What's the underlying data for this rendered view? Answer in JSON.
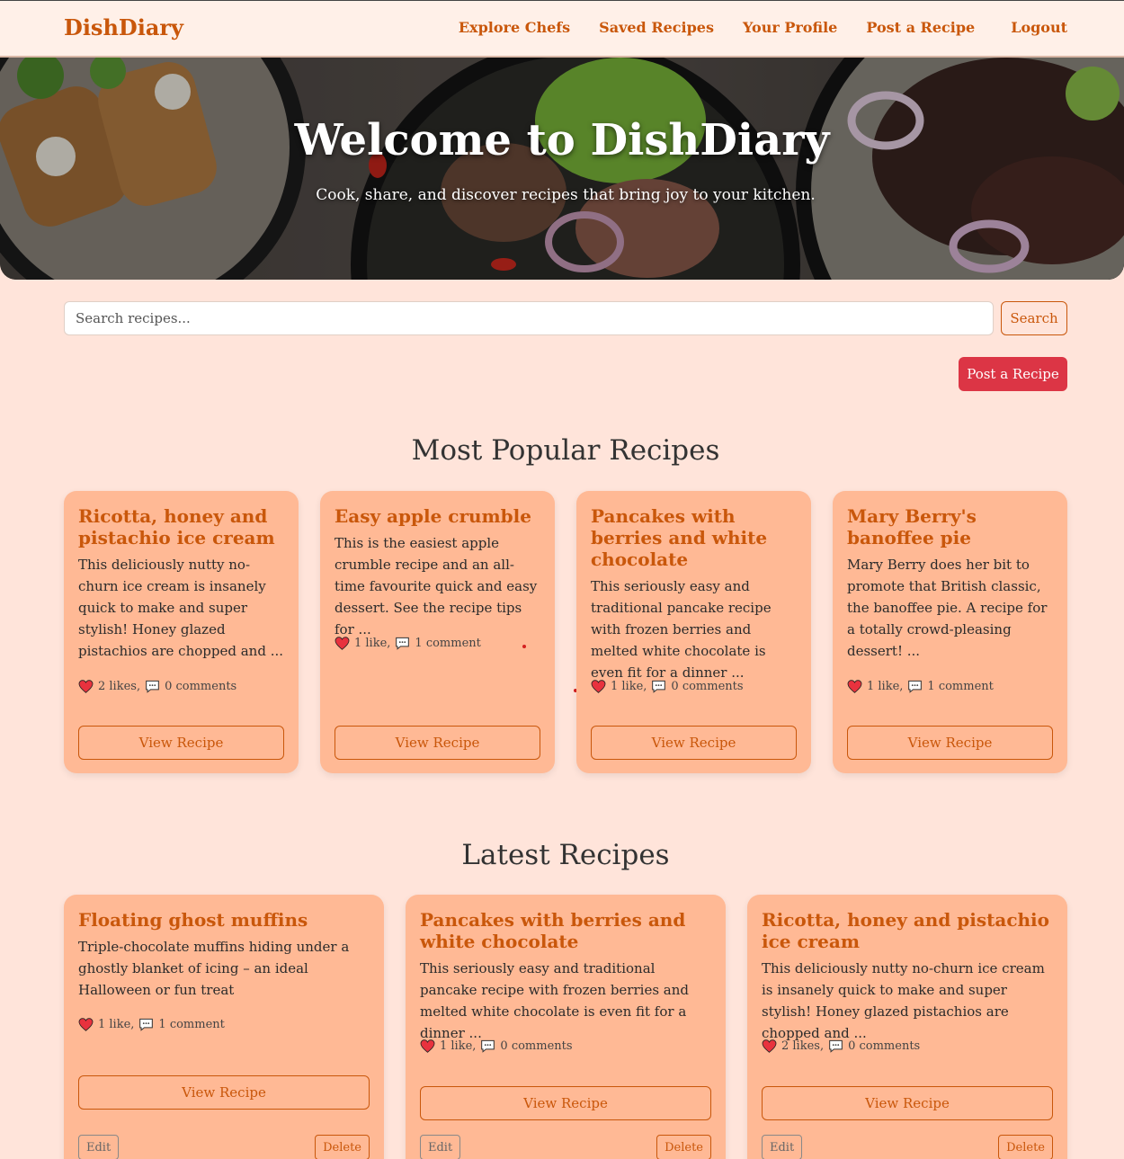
{
  "nav": {
    "brand": "DishDiary",
    "links": [
      "Explore Chefs",
      "Saved Recipes",
      "Your Profile",
      "Post a Recipe",
      "Logout"
    ]
  },
  "hero": {
    "title": "Welcome to DishDiary",
    "subtitle": "Cook, share, and discover recipes that bring joy to your kitchen."
  },
  "search": {
    "placeholder": "Search recipes...",
    "button": "Search"
  },
  "post_button": "Post a Recipe",
  "popular": {
    "heading": "Most Popular Recipes",
    "cards": [
      {
        "title": "Ricotta, honey and pistachio ice cream",
        "desc": "This deliciously nutty no-churn ice cream is insanely quick to make and super stylish! Honey glazed pistachios are chopped and ...",
        "likes": "2 likes,",
        "comments": "0 comments",
        "button": "View Recipe"
      },
      {
        "title": "Easy apple crumble",
        "desc": "This is the easiest apple crumble recipe and an all-time favourite quick and easy dessert. See the recipe tips for ...",
        "likes": "1 like,",
        "comments": "1 comment",
        "button": "View Recipe"
      },
      {
        "title": "Pancakes with berries and white chocolate",
        "desc": "This seriously easy and traditional pancake recipe with frozen berries and melted white chocolate is even fit for a dinner ...",
        "likes": "1 like,",
        "comments": "0 comments",
        "button": "View Recipe"
      },
      {
        "title": "Mary Berry's banoffee pie",
        "desc": "Mary Berry does her bit to promote that British classic, the banoffee pie. A recipe for a totally crowd-pleasing dessert! ...",
        "likes": "1 like,",
        "comments": "1 comment",
        "button": "View Recipe"
      }
    ]
  },
  "latest": {
    "heading": "Latest Recipes",
    "cards": [
      {
        "title": "Floating ghost muffins",
        "desc": "Triple-chocolate muffins hiding under a ghostly blanket of icing – an ideal Halloween or fun treat",
        "likes": "1 like,",
        "comments": "1 comment",
        "button": "View Recipe",
        "edit": "Edit",
        "delete": "Delete"
      },
      {
        "title": "Pancakes with berries and white chocolate",
        "desc": "This seriously easy and traditional pancake recipe with frozen berries and melted white chocolate is even fit for a dinner ...",
        "likes": "1 like,",
        "comments": "0 comments",
        "button": "View Recipe",
        "edit": "Edit",
        "delete": "Delete"
      },
      {
        "title": "Ricotta, honey and pistachio ice cream",
        "desc": "This deliciously nutty no-churn ice cream is insanely quick to make and super stylish! Honey glazed pistachios are chopped and ...",
        "likes": "2 likes,",
        "comments": "0 comments",
        "button": "View Recipe",
        "edit": "Edit",
        "delete": "Delete"
      }
    ]
  }
}
